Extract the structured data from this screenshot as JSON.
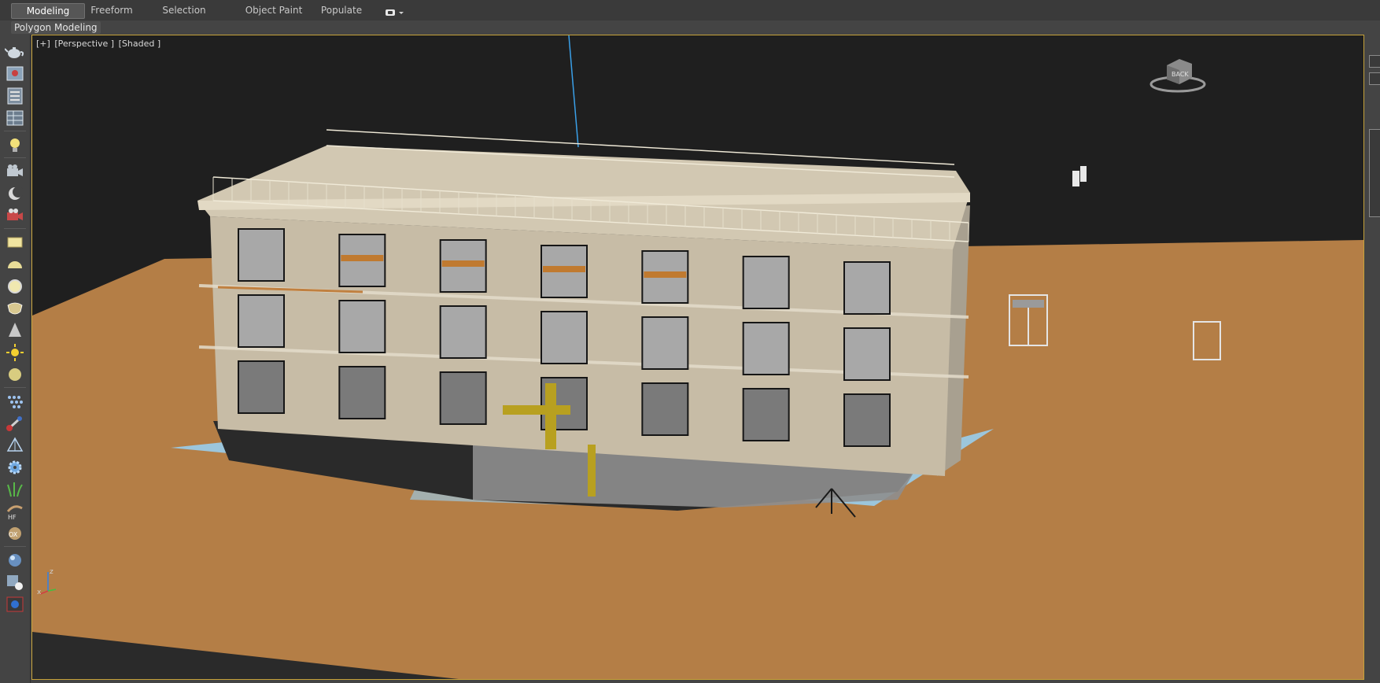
{
  "ribbon": {
    "tabs": [
      {
        "label": "Modeling",
        "active": true
      },
      {
        "label": "Freeform",
        "active": false
      },
      {
        "label": "Selection",
        "active": false
      },
      {
        "label": "Object Paint",
        "active": false
      },
      {
        "label": "Populate",
        "active": false
      }
    ],
    "extra_icon": "toggle-options-icon",
    "sub_panel": "Polygon Modeling"
  },
  "viewport": {
    "label_plus": "[+]",
    "label_view": "[Perspective ]",
    "label_shading": "[Shaded ]",
    "viewcube_face": "BACK",
    "axis_z": "z",
    "axis_x": "x",
    "active_border_color": "#c6a23a",
    "ground_color": "#b47e46",
    "background_color": "#1f1f1f"
  },
  "toolbar": {
    "icons": [
      "teapot-icon",
      "render-frame-icon",
      "material-editor-icon",
      "layer-manager-icon",
      "light-icon",
      "camera-icon",
      "moon-light-icon",
      "camera-target-icon",
      "plane-icon",
      "hemisphere-icon",
      "ring-icon",
      "hedra-icon",
      "cone-icon",
      "sun-icon",
      "sphere-icon",
      "particle-icon",
      "bone-icon",
      "pyramid-icon",
      "gear-icon",
      "grass-icon",
      "hair-fur-icon",
      "cloth-icon",
      "glass-sphere-icon",
      "shape-icon",
      "render-icon"
    ]
  }
}
